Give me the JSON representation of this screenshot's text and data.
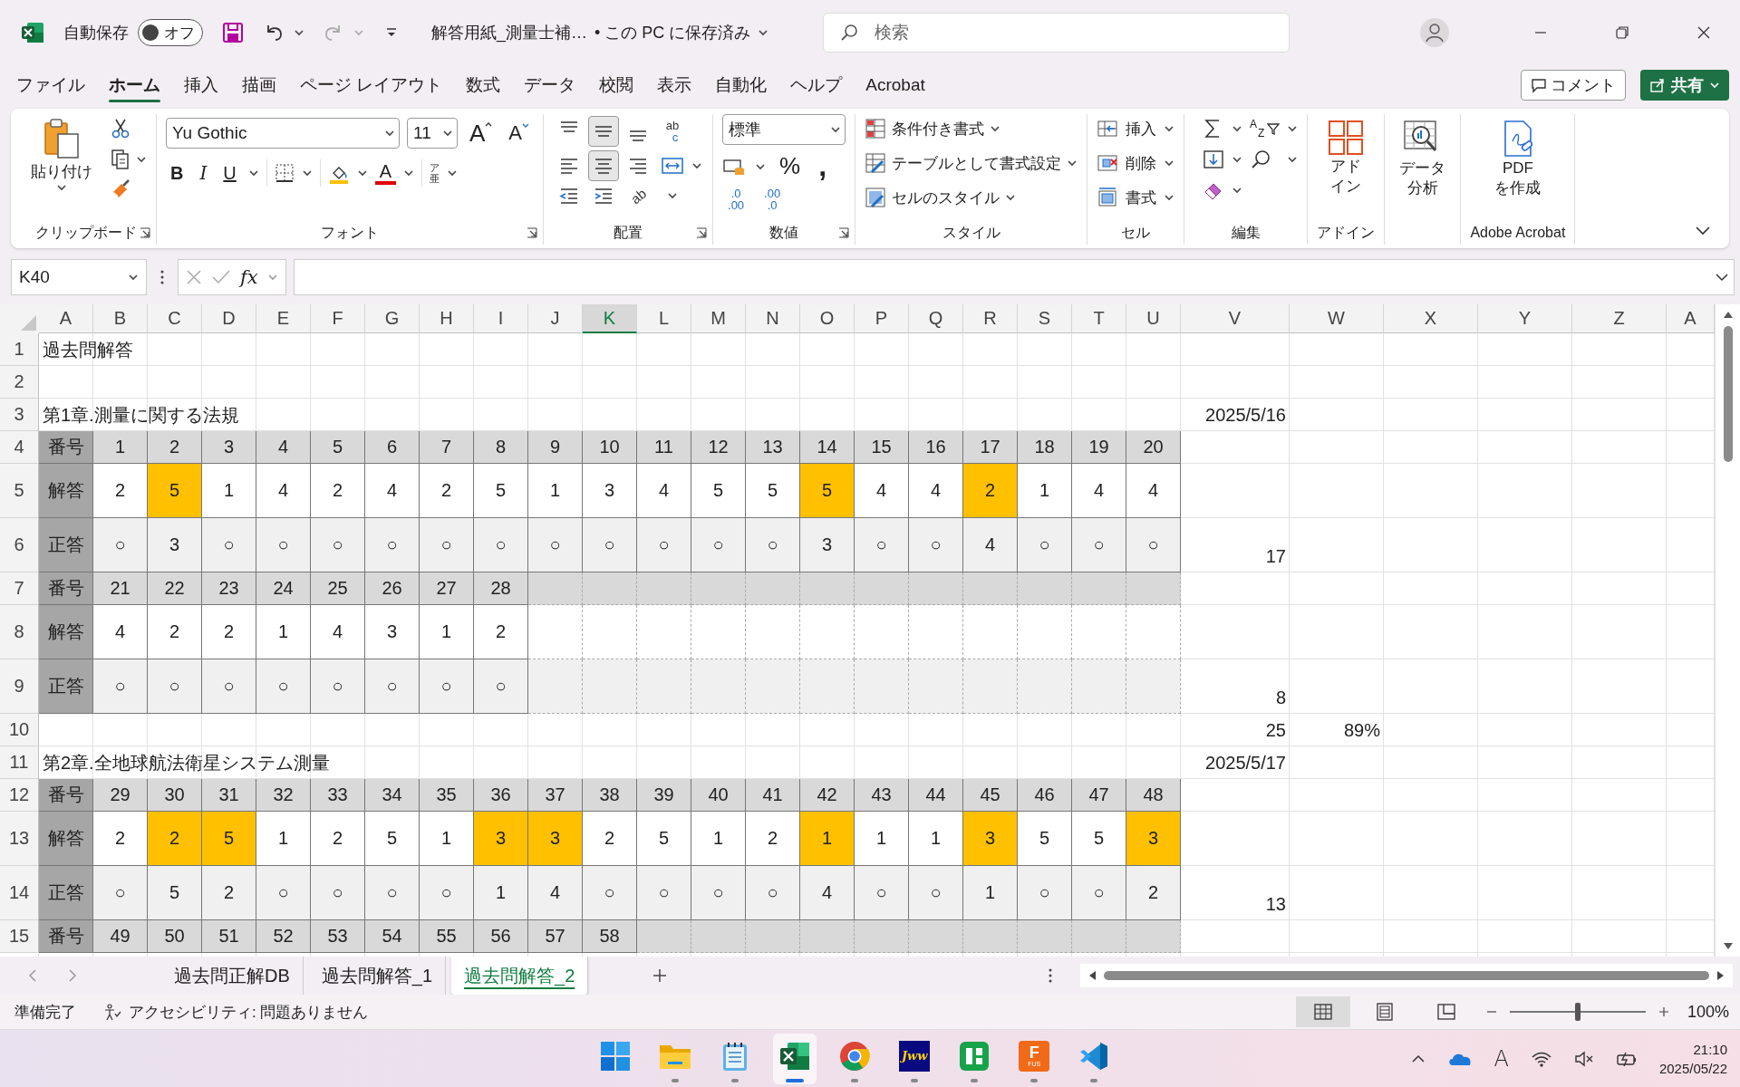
{
  "title_bar": {
    "autosave": {
      "label": "自動保存",
      "on": false,
      "text": "オフ"
    },
    "document": "解答用紙_測量士補…",
    "save_status": "• この PC に保存済み",
    "search": {
      "placeholder": "検索"
    }
  },
  "menu_tabs": [
    {
      "label": "ファイル",
      "selected": false
    },
    {
      "label": "ホーム",
      "selected": true
    },
    {
      "label": "挿入",
      "selected": false
    },
    {
      "label": "描画",
      "selected": false
    },
    {
      "label": "ページ レイアウト",
      "selected": false
    },
    {
      "label": "数式",
      "selected": false
    },
    {
      "label": "データ",
      "selected": false
    },
    {
      "label": "校閲",
      "selected": false
    },
    {
      "label": "表示",
      "selected": false
    },
    {
      "label": "自動化",
      "selected": false
    },
    {
      "label": "ヘルプ",
      "selected": false
    },
    {
      "label": "Acrobat",
      "selected": false
    }
  ],
  "comment_button": "コメント",
  "share_button": "共有",
  "ribbon": {
    "clipboard": {
      "label": "クリップボード",
      "paste": "貼り付け"
    },
    "font": {
      "label": "フォント",
      "name": "Yu Gothic",
      "size": "11",
      "grow": "A",
      "shrink": "A",
      "styles": [
        "B",
        "I",
        "U"
      ],
      "color_letter": "A",
      "phonetic": [
        "ア",
        "亜"
      ]
    },
    "alignment": {
      "label": "配置",
      "vertical": [
        {
          "selected": false
        },
        {
          "selected": true
        },
        {
          "selected": false
        }
      ],
      "horizontal": [
        {
          "selected": false
        },
        {
          "selected": true
        },
        {
          "selected": false
        }
      ],
      "wrap": [
        "ab",
        "c"
      ],
      "orientation": "ab"
    },
    "number": {
      "label": "数値",
      "format": "標準",
      "percent": "%",
      "comma": ",",
      "increase_decimal": [
        ".0",
        ".00"
      ],
      "decrease_decimal": [
        ".00",
        ".0"
      ]
    },
    "styles": {
      "label": "スタイル",
      "buttons": [
        "条件付き書式",
        "テーブルとして書式設定",
        "セルのスタイル"
      ]
    },
    "cells": {
      "label": "セル",
      "buttons": [
        "挿入",
        "削除",
        "書式"
      ]
    },
    "editing": {
      "label": "編集",
      "sort": [
        "A",
        "Z"
      ]
    },
    "addins": {
      "label": "アドイン",
      "button": [
        "アド",
        "イン"
      ]
    },
    "analysis": {
      "button": [
        "データ",
        "分析"
      ]
    },
    "acrobat": {
      "label": "Adobe Acrobat",
      "button": [
        "PDF",
        "を作成"
      ]
    }
  },
  "formula_bar": {
    "name_box": "K40",
    "function": "fx"
  },
  "sheet": {
    "columns": [
      {
        "label": "A",
        "selected": false
      },
      {
        "label": "B",
        "selected": false
      },
      {
        "label": "C",
        "selected": false
      },
      {
        "label": "D",
        "selected": false
      },
      {
        "label": "E",
        "selected": false
      },
      {
        "label": "F",
        "selected": false
      },
      {
        "label": "G",
        "selected": false
      },
      {
        "label": "H",
        "selected": false
      },
      {
        "label": "I",
        "selected": false
      },
      {
        "label": "J",
        "selected": false
      },
      {
        "label": "K",
        "selected": true
      },
      {
        "label": "L",
        "selected": false
      },
      {
        "label": "M",
        "selected": false
      },
      {
        "label": "N",
        "selected": false
      },
      {
        "label": "O",
        "selected": false
      },
      {
        "label": "P",
        "selected": false
      },
      {
        "label": "Q",
        "selected": false
      },
      {
        "label": "R",
        "selected": false
      },
      {
        "label": "S",
        "selected": false
      },
      {
        "label": "T",
        "selected": false
      },
      {
        "label": "U",
        "selected": false
      },
      {
        "label": "V",
        "selected": false
      },
      {
        "label": "W",
        "selected": false
      },
      {
        "label": "X",
        "selected": false
      },
      {
        "label": "Y",
        "selected": false
      },
      {
        "label": "Z",
        "selected": false
      },
      {
        "label": "A",
        "selected": false
      }
    ],
    "rows": [
      {
        "number": "1",
        "kind": "title",
        "text": "過去問解答"
      },
      {
        "number": "2",
        "kind": "blank"
      },
      {
        "number": "3",
        "kind": "section",
        "text": "第1章.測量に関する法規",
        "side": "2025/5/16"
      },
      {
        "number": "4",
        "kind": "number",
        "label": "番号",
        "values": [
          "1",
          "2",
          "3",
          "4",
          "5",
          "6",
          "7",
          "8",
          "9",
          "10",
          "11",
          "12",
          "13",
          "14",
          "15",
          "16",
          "17",
          "18",
          "19",
          "20"
        ]
      },
      {
        "number": "5",
        "kind": "answer",
        "label": "解答",
        "values": [
          {
            "text": "2",
            "wrong": false
          },
          {
            "text": "5",
            "wrong": true
          },
          {
            "text": "1",
            "wrong": false
          },
          {
            "text": "4",
            "wrong": false
          },
          {
            "text": "2",
            "wrong": false
          },
          {
            "text": "4",
            "wrong": false
          },
          {
            "text": "2",
            "wrong": false
          },
          {
            "text": "5",
            "wrong": false
          },
          {
            "text": "1",
            "wrong": false
          },
          {
            "text": "3",
            "wrong": false
          },
          {
            "text": "4",
            "wrong": false
          },
          {
            "text": "5",
            "wrong": false
          },
          {
            "text": "5",
            "wrong": false
          },
          {
            "text": "5",
            "wrong": true
          },
          {
            "text": "4",
            "wrong": false
          },
          {
            "text": "4",
            "wrong": false
          },
          {
            "text": "2",
            "wrong": true
          },
          {
            "text": "1",
            "wrong": false
          },
          {
            "text": "4",
            "wrong": false
          },
          {
            "text": "4",
            "wrong": false
          }
        ]
      },
      {
        "number": "6",
        "kind": "correct",
        "label": "正答",
        "values": [
          "○",
          "3",
          "○",
          "○",
          "○",
          "○",
          "○",
          "○",
          "○",
          "○",
          "○",
          "○",
          "○",
          "3",
          "○",
          "○",
          "4",
          "○",
          "○",
          "○"
        ],
        "side": "17"
      },
      {
        "number": "7",
        "kind": "number",
        "label": "番号",
        "values": [
          "21",
          "22",
          "23",
          "24",
          "25",
          "26",
          "27",
          "28"
        ]
      },
      {
        "number": "8",
        "kind": "answer",
        "label": "解答",
        "values": [
          {
            "text": "4",
            "wrong": false
          },
          {
            "text": "2",
            "wrong": false
          },
          {
            "text": "2",
            "wrong": false
          },
          {
            "text": "1",
            "wrong": false
          },
          {
            "text": "4",
            "wrong": false
          },
          {
            "text": "3",
            "wrong": false
          },
          {
            "text": "1",
            "wrong": false
          },
          {
            "text": "2",
            "wrong": false
          }
        ]
      },
      {
        "number": "9",
        "kind": "correct",
        "label": "正答",
        "values": [
          "○",
          "○",
          "○",
          "○",
          "○",
          "○",
          "○",
          "○"
        ],
        "side": "8"
      },
      {
        "number": "10",
        "kind": "blank",
        "side": "25",
        "extra": "89%"
      },
      {
        "number": "11",
        "kind": "section",
        "text": "第2章.全地球航法衛星システム測量",
        "side": "2025/5/17"
      },
      {
        "number": "12",
        "kind": "number",
        "label": "番号",
        "values": [
          "29",
          "30",
          "31",
          "32",
          "33",
          "34",
          "35",
          "36",
          "37",
          "38",
          "39",
          "40",
          "41",
          "42",
          "43",
          "44",
          "45",
          "46",
          "47",
          "48"
        ]
      },
      {
        "number": "13",
        "kind": "answer",
        "label": "解答",
        "values": [
          {
            "text": "2",
            "wrong": false
          },
          {
            "text": "2",
            "wrong": true
          },
          {
            "text": "5",
            "wrong": true
          },
          {
            "text": "1",
            "wrong": false
          },
          {
            "text": "2",
            "wrong": false
          },
          {
            "text": "5",
            "wrong": false
          },
          {
            "text": "1",
            "wrong": false
          },
          {
            "text": "3",
            "wrong": true
          },
          {
            "text": "3",
            "wrong": true
          },
          {
            "text": "2",
            "wrong": false
          },
          {
            "text": "5",
            "wrong": false
          },
          {
            "text": "1",
            "wrong": false
          },
          {
            "text": "2",
            "wrong": false
          },
          {
            "text": "1",
            "wrong": true
          },
          {
            "text": "1",
            "wrong": false
          },
          {
            "text": "1",
            "wrong": false
          },
          {
            "text": "3",
            "wrong": true
          },
          {
            "text": "5",
            "wrong": false
          },
          {
            "text": "5",
            "wrong": false
          },
          {
            "text": "3",
            "wrong": true
          }
        ]
      },
      {
        "number": "14",
        "kind": "correct",
        "label": "正答",
        "values": [
          "○",
          "5",
          "2",
          "○",
          "○",
          "○",
          "○",
          "1",
          "4",
          "○",
          "○",
          "○",
          "○",
          "4",
          "○",
          "○",
          "1",
          "○",
          "○",
          "2"
        ],
        "side": "13"
      },
      {
        "number": "15",
        "kind": "number",
        "label": "番号",
        "values": [
          "49",
          "50",
          "51",
          "52",
          "53",
          "54",
          "55",
          "56",
          "57",
          "58"
        ]
      }
    ]
  },
  "sheet_tabs": [
    {
      "label": "過去問正解DB",
      "selected": false
    },
    {
      "label": "過去問解答_1",
      "selected": false
    },
    {
      "label": "過去問解答_2",
      "selected": true
    }
  ],
  "status_bar": {
    "ready": "準備完了",
    "accessibility": "アクセシビリティ: 問題ありません",
    "views": [
      {
        "selected": true
      },
      {
        "selected": false
      },
      {
        "selected": false
      }
    ],
    "zoom": {
      "level": 0.5,
      "text": "100%"
    }
  },
  "taskbar": {
    "apps": [
      {
        "kind": "start",
        "selected": false,
        "running": false
      },
      {
        "kind": "folder",
        "selected": false,
        "running": true
      },
      {
        "kind": "notepad",
        "selected": false,
        "running": true
      },
      {
        "kind": "spreadsheet",
        "selected": true,
        "running": true
      },
      {
        "kind": "browser",
        "selected": false,
        "running": true
      },
      {
        "kind": "jww",
        "label": "Jww",
        "selected": false,
        "running": true
      },
      {
        "kind": "green",
        "selected": false,
        "running": true
      },
      {
        "kind": "fus",
        "label": "F",
        "sublabel": "FUS",
        "selected": false,
        "running": true
      },
      {
        "kind": "code",
        "selected": false,
        "running": true
      }
    ],
    "tray": {
      "ime": "A",
      "time": "21:10",
      "date": "2025/05/22"
    }
  }
}
